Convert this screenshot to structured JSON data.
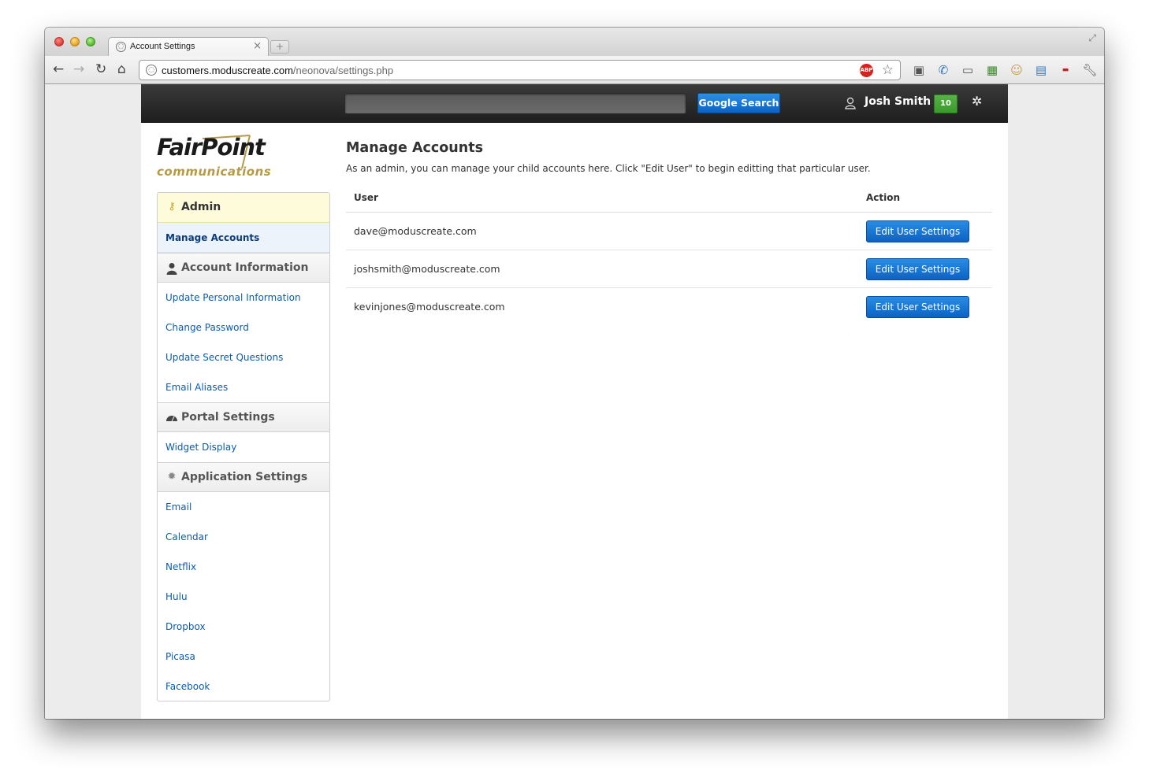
{
  "browser": {
    "tab_title": "Account Settings",
    "url_host": "customers.moduscreate.com",
    "url_path": "/neonova/settings.php",
    "abp_label": "ABP"
  },
  "topbar": {
    "search_placeholder": "",
    "search_button": "Google Search",
    "user_name": "Josh Smith",
    "badge_count": "10"
  },
  "logo": {
    "line1": "FairPoint",
    "line2": "communications"
  },
  "sidebar": {
    "sections": [
      {
        "title": "Admin",
        "icon": "key-icon",
        "items": [
          "Manage Accounts"
        ]
      },
      {
        "title": "Account Information",
        "icon": "person-icon",
        "items": [
          "Update Personal Information",
          "Change Password",
          "Update Secret Questions",
          "Email Aliases"
        ]
      },
      {
        "title": "Portal Settings",
        "icon": "speedometer-icon",
        "items": [
          "Widget Display"
        ]
      },
      {
        "title": "Application Settings",
        "icon": "cog-icon",
        "items": [
          "Email",
          "Calendar",
          "Netflix",
          "Hulu",
          "Dropbox",
          "Picasa",
          "Facebook"
        ]
      }
    ]
  },
  "main": {
    "title": "Manage Accounts",
    "description": "As an admin, you can manage your child accounts here. Click \"Edit User\" to begin editting that particular user.",
    "columns": [
      "User",
      "Action"
    ],
    "rows": [
      {
        "email": "dave@moduscreate.com",
        "action": "Edit User Settings"
      },
      {
        "email": "joshsmith@moduscreate.com",
        "action": "Edit User Settings"
      },
      {
        "email": "kevinjones@moduscreate.com",
        "action": "Edit User Settings"
      }
    ]
  },
  "colors": {
    "accent_blue": "#0b63c5",
    "link_blue": "#0b5cad",
    "badge_green": "#3a9a2c",
    "logo_gold": "#b59a47",
    "admin_highlight": "#fdfbd9"
  }
}
